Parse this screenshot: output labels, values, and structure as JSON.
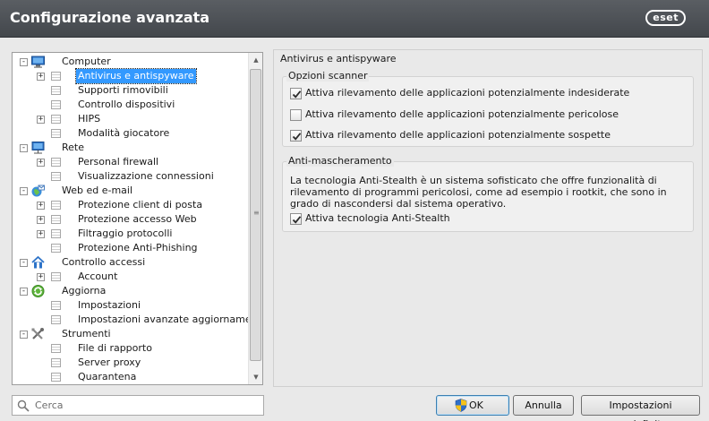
{
  "window": {
    "title": "Configurazione avanzata",
    "logo": "eset"
  },
  "tree": {
    "selected": "Antivirus e antispyware",
    "items": [
      {
        "label": "Computer",
        "icon": "monitor-icon",
        "level": 0,
        "expander": "-"
      },
      {
        "label": "Antivirus e antispyware",
        "icon": "page-icon",
        "level": 1,
        "expander": "+"
      },
      {
        "label": "Supporti rimovibili",
        "icon": "page-icon",
        "level": 1,
        "expander": ""
      },
      {
        "label": "Controllo dispositivi",
        "icon": "page-icon",
        "level": 1,
        "expander": ""
      },
      {
        "label": "HIPS",
        "icon": "page-icon",
        "level": 1,
        "expander": "+"
      },
      {
        "label": "Modalità giocatore",
        "icon": "page-icon",
        "level": 1,
        "expander": ""
      },
      {
        "label": "Rete",
        "icon": "network-icon",
        "level": 0,
        "expander": "-"
      },
      {
        "label": "Personal firewall",
        "icon": "page-icon",
        "level": 1,
        "expander": "+"
      },
      {
        "label": "Visualizzazione connessioni",
        "icon": "page-icon",
        "level": 1,
        "expander": ""
      },
      {
        "label": "Web ed e-mail",
        "icon": "globe-icon",
        "level": 0,
        "expander": "-"
      },
      {
        "label": "Protezione client di posta",
        "icon": "page-icon",
        "level": 1,
        "expander": "+"
      },
      {
        "label": "Protezione accesso Web",
        "icon": "page-icon",
        "level": 1,
        "expander": "+"
      },
      {
        "label": "Filtraggio protocolli",
        "icon": "page-icon",
        "level": 1,
        "expander": "+"
      },
      {
        "label": "Protezione Anti-Phishing",
        "icon": "page-icon",
        "level": 1,
        "expander": ""
      },
      {
        "label": "Controllo accessi",
        "icon": "family-icon",
        "level": 0,
        "expander": "-"
      },
      {
        "label": "Account",
        "icon": "page-icon",
        "level": 1,
        "expander": "+"
      },
      {
        "label": "Aggiorna",
        "icon": "update-icon",
        "level": 0,
        "expander": "-"
      },
      {
        "label": "Impostazioni",
        "icon": "page-icon",
        "level": 1,
        "expander": ""
      },
      {
        "label": "Impostazioni avanzate aggiornamento",
        "icon": "page-icon",
        "level": 1,
        "expander": ""
      },
      {
        "label": "Strumenti",
        "icon": "tools-icon",
        "level": 0,
        "expander": "-"
      },
      {
        "label": "File di rapporto",
        "icon": "page-icon",
        "level": 1,
        "expander": ""
      },
      {
        "label": "Server proxy",
        "icon": "page-icon",
        "level": 1,
        "expander": ""
      },
      {
        "label": "Quarantena",
        "icon": "page-icon",
        "level": 1,
        "expander": ""
      }
    ]
  },
  "search": {
    "placeholder": "Cerca"
  },
  "panel": {
    "title": "Antivirus e antispyware",
    "scanner": {
      "legend": "Opzioni scanner",
      "options": [
        {
          "label": "Attiva rilevamento delle applicazioni potenzialmente indesiderate",
          "checked": true
        },
        {
          "label": "Attiva rilevamento delle applicazioni potenzialmente pericolose",
          "checked": false
        },
        {
          "label": "Attiva rilevamento delle applicazioni potenzialmente sospette",
          "checked": true
        }
      ]
    },
    "antistealth": {
      "legend": "Anti-mascheramento",
      "description": "La tecnologia Anti-Stealth è un sistema sofisticato che offre funzionalità di rilevamento di programmi pericolosi, come ad esempio i rootkit, che sono in grado di nascondersi dal sistema operativo.",
      "option": {
        "label": "Attiva tecnologia Anti-Stealth",
        "checked": true
      }
    }
  },
  "buttons": {
    "ok": "OK",
    "cancel": "Annulla",
    "defaults": "Impostazioni predefinite"
  },
  "colors": {
    "titlebar": "#4b4f54",
    "selection": "#3399ff"
  }
}
